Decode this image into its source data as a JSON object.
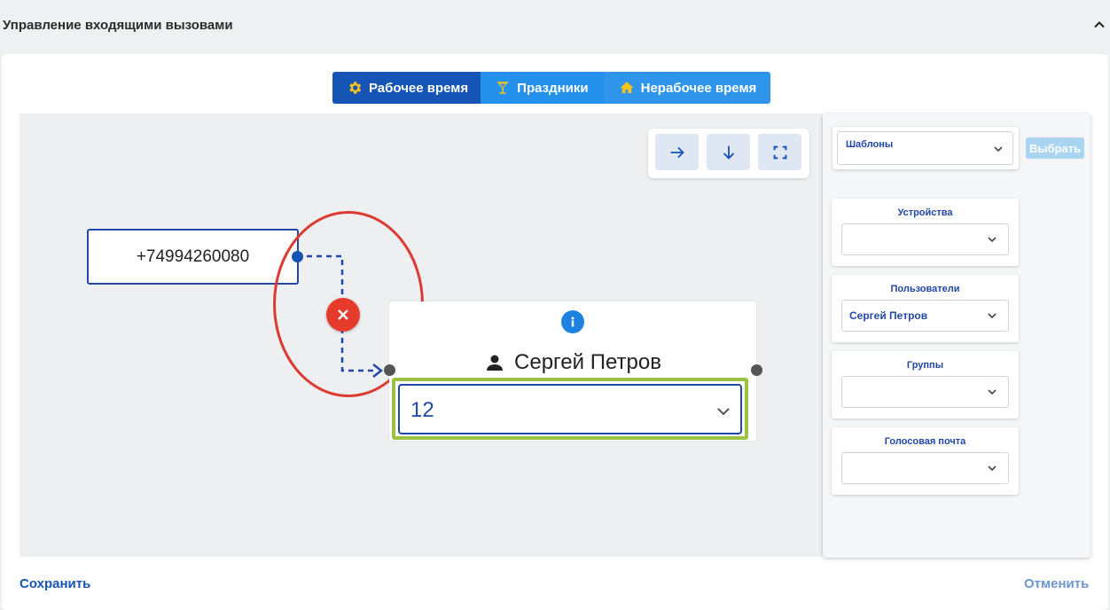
{
  "header": {
    "title": "Управление входящими вызовами",
    "collapse_icon": "chevron-up-icon"
  },
  "tabs": [
    {
      "label": "Рабочее время",
      "icon": "gear-icon",
      "active": true
    },
    {
      "label": "Праздники",
      "icon": "cocktail-icon",
      "active": false
    },
    {
      "label": "Нерабочее время",
      "icon": "home-icon",
      "active": false
    }
  ],
  "toolbar": {
    "buttons": [
      "arrow-right-icon",
      "arrow-down-icon",
      "fullscreen-icon"
    ]
  },
  "flow": {
    "phone_number": "+74994260080",
    "user_name": "Сергей Петров",
    "extension_value": "12"
  },
  "panel": {
    "templates_label": "Шаблоны",
    "pick_button": "Выбрать",
    "groups": [
      {
        "title": "Устройства",
        "value": ""
      },
      {
        "title": "Пользователи",
        "value": "Сергей Петров"
      },
      {
        "title": "Группы",
        "value": ""
      },
      {
        "title": "Голосовая почта",
        "value": ""
      }
    ]
  },
  "footer": {
    "save_label": "Сохранить",
    "cancel_label": "Отменить"
  },
  "colors": {
    "primary": "#1654b6",
    "tab_secondary": "#2491ec",
    "delete_red": "#e53a2c",
    "highlight_green": "#9bc241",
    "highlight_red": "#db3b33"
  }
}
